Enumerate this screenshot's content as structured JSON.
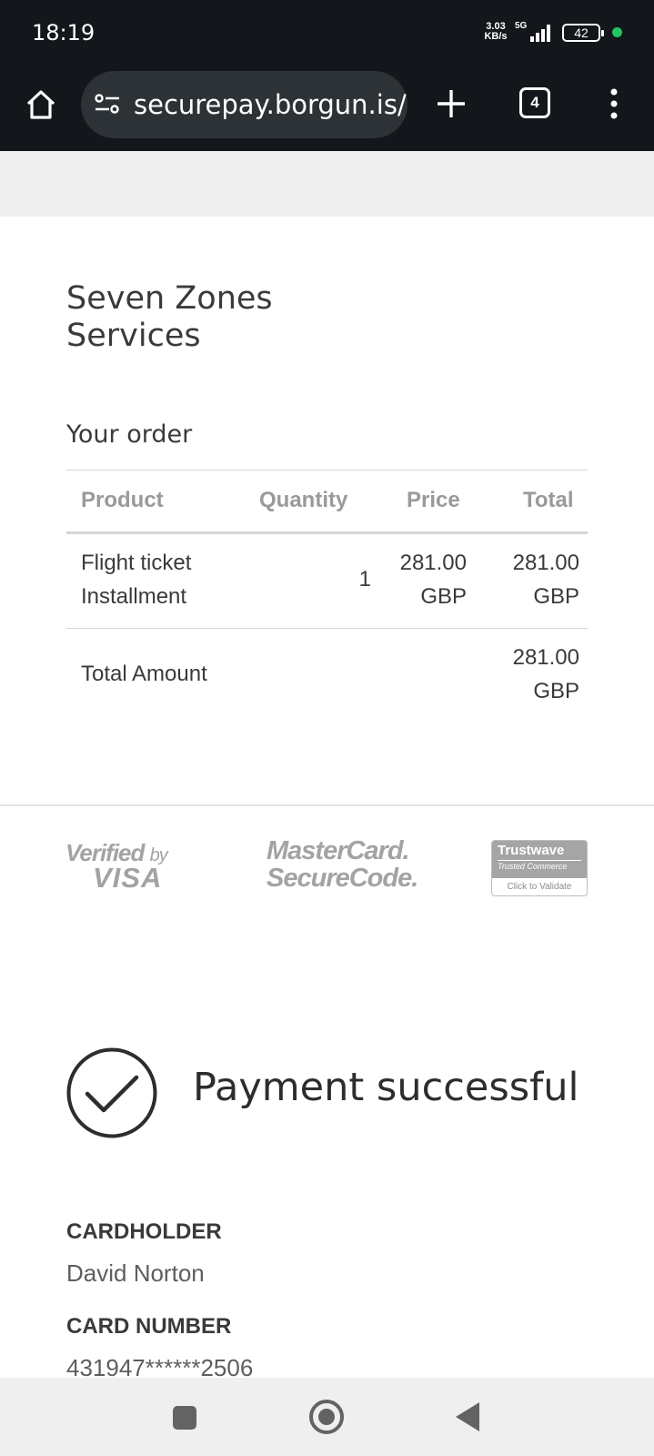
{
  "status_bar": {
    "time": "18:19",
    "speed_value": "3.03",
    "speed_unit": "KB/s",
    "network": "5G",
    "battery": "42",
    "dot_color": "#22c55e"
  },
  "browser": {
    "url": "securepay.borgun.is/s",
    "tab_count": "4"
  },
  "merchant": {
    "line1": "Seven Zones",
    "line2": "Services"
  },
  "order": {
    "title": "Your order",
    "headers": {
      "product": "Product",
      "quantity": "Quantity",
      "price": "Price",
      "total": "Total"
    },
    "items": [
      {
        "product_line1": "Flight ticket",
        "product_line2": "Installment",
        "quantity": "1",
        "price_amount": "281.00",
        "price_currency": "GBP",
        "total_amount": "281.00",
        "total_currency": "GBP"
      }
    ],
    "total_label": "Total Amount",
    "total_amount": "281.00",
    "total_currency": "GBP"
  },
  "logos": {
    "vbv_line1": "Verified",
    "vbv_by": "by",
    "vbv_line2": "VISA",
    "mc_line1": "MasterCard.",
    "mc_line2": "SecureCode.",
    "trustwave_name": "Trustwave",
    "trustwave_sub": "Trusted Commerce",
    "trustwave_action": "Click to Validate"
  },
  "result": {
    "message": "Payment successful"
  },
  "card": {
    "cardholder_label": "CARDHOLDER",
    "cardholder_value": "David Norton",
    "number_label": "CARD NUMBER",
    "number_value": "431947******2506"
  }
}
